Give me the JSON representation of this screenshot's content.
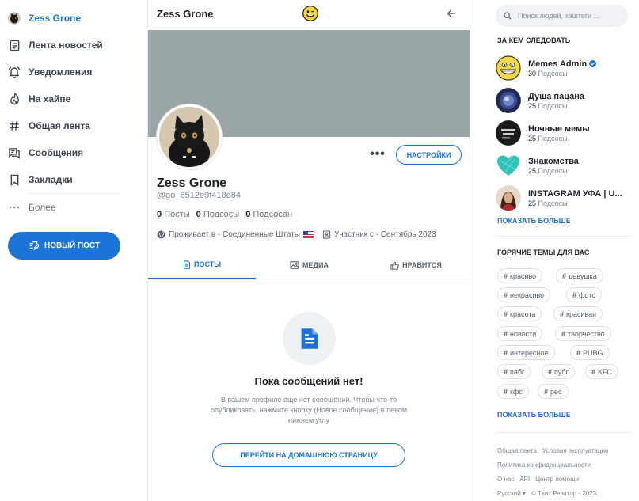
{
  "sidebar": {
    "items": [
      {
        "label": "Zess Grone",
        "icon": "profile-avatar"
      },
      {
        "label": "Лента новостей",
        "icon": "feed-icon"
      },
      {
        "label": "Уведомления",
        "icon": "bell-icon"
      },
      {
        "label": "На хайпе",
        "icon": "flame-icon"
      },
      {
        "label": "Общая лента",
        "icon": "hashtag-icon"
      },
      {
        "label": "Сообщения",
        "icon": "messages-icon"
      },
      {
        "label": "Закладки",
        "icon": "bookmark-icon"
      },
      {
        "label": "Более",
        "icon": "dots-icon"
      }
    ],
    "new_post_label": "НОВЫЙ ПОСТ"
  },
  "main": {
    "title": "Zess Grone",
    "settings_label": "НАСТРОЙКИ",
    "more_label": "•••",
    "profile": {
      "name": "Zess Grone",
      "handle": "@go_6512e9f418e84",
      "posts_count": "0",
      "posts_label": "Посты",
      "following_count": "0",
      "following_label": "Подсосы",
      "followers_count": "0",
      "followers_label": "Подсосан",
      "location": "Проживает в - Соединенные Штаты",
      "member_since": "Участник с - Сентябрь 2023"
    },
    "tabs": [
      {
        "label": "ПОСТЫ",
        "active": true
      },
      {
        "label": "МЕДИА",
        "active": false
      },
      {
        "label": "НРАВИТСЯ",
        "active": false
      }
    ],
    "empty": {
      "title": "Пока сообщений нет!",
      "description": "В вашем профиле еще нет сообщений. Чтобы что-то опубликовать, нажмите кнопку (Новое сообщение) в левом нижнем углу",
      "button_label": "ПЕРЕЙТИ НА ДОМАШНЮЮ СТРАНИЦУ"
    }
  },
  "right": {
    "search_placeholder": "Поиск людей, хэштеги ...",
    "follow_title": "ЗА КЕМ СЛЕДОВАТЬ",
    "follow_list": [
      {
        "name": "Memes Admin",
        "count": "30",
        "label": "Подсосы",
        "verified": true
      },
      {
        "name": "Душа пацана",
        "count": "25",
        "label": "Подсосы"
      },
      {
        "name": "Ночные мемы",
        "count": "25",
        "label": "Подсосы"
      },
      {
        "name": "Знакомства",
        "count": "25",
        "label": "Подсосы"
      },
      {
        "name": "INSTAGRAM УФА | U...",
        "count": "25",
        "label": "Подсосы"
      }
    ],
    "show_more_label": "ПОКАЗАТЬ БОЛЬШЕ",
    "topics_title": "ГОРЯЧИЕ ТЕМЫ ДЛЯ ВАС",
    "topics": [
      "красиво",
      "девушка",
      "некрасиво",
      "фото",
      "красота",
      "красивая",
      "новости",
      "творчество",
      "интересное",
      "PUBG",
      "пабг",
      "пубг",
      "KFC",
      "кфс",
      "рес"
    ],
    "show_more_label_2": "ПОКАЗАТЬ БОЛЬШЕ",
    "footer": {
      "links_row1": [
        "Общая лента",
        "Условия эксплуатации"
      ],
      "links_row2": [
        "Политика конфиденциальности"
      ],
      "links_row3": [
        "О нас",
        "API",
        "Центр помощи"
      ],
      "language": "Русский",
      "copyright": "© Твит Реактор - 2023."
    }
  },
  "colors": {
    "accent": "#1d72d6",
    "cover": "#99a5a6",
    "verified": "#1d72d6"
  }
}
